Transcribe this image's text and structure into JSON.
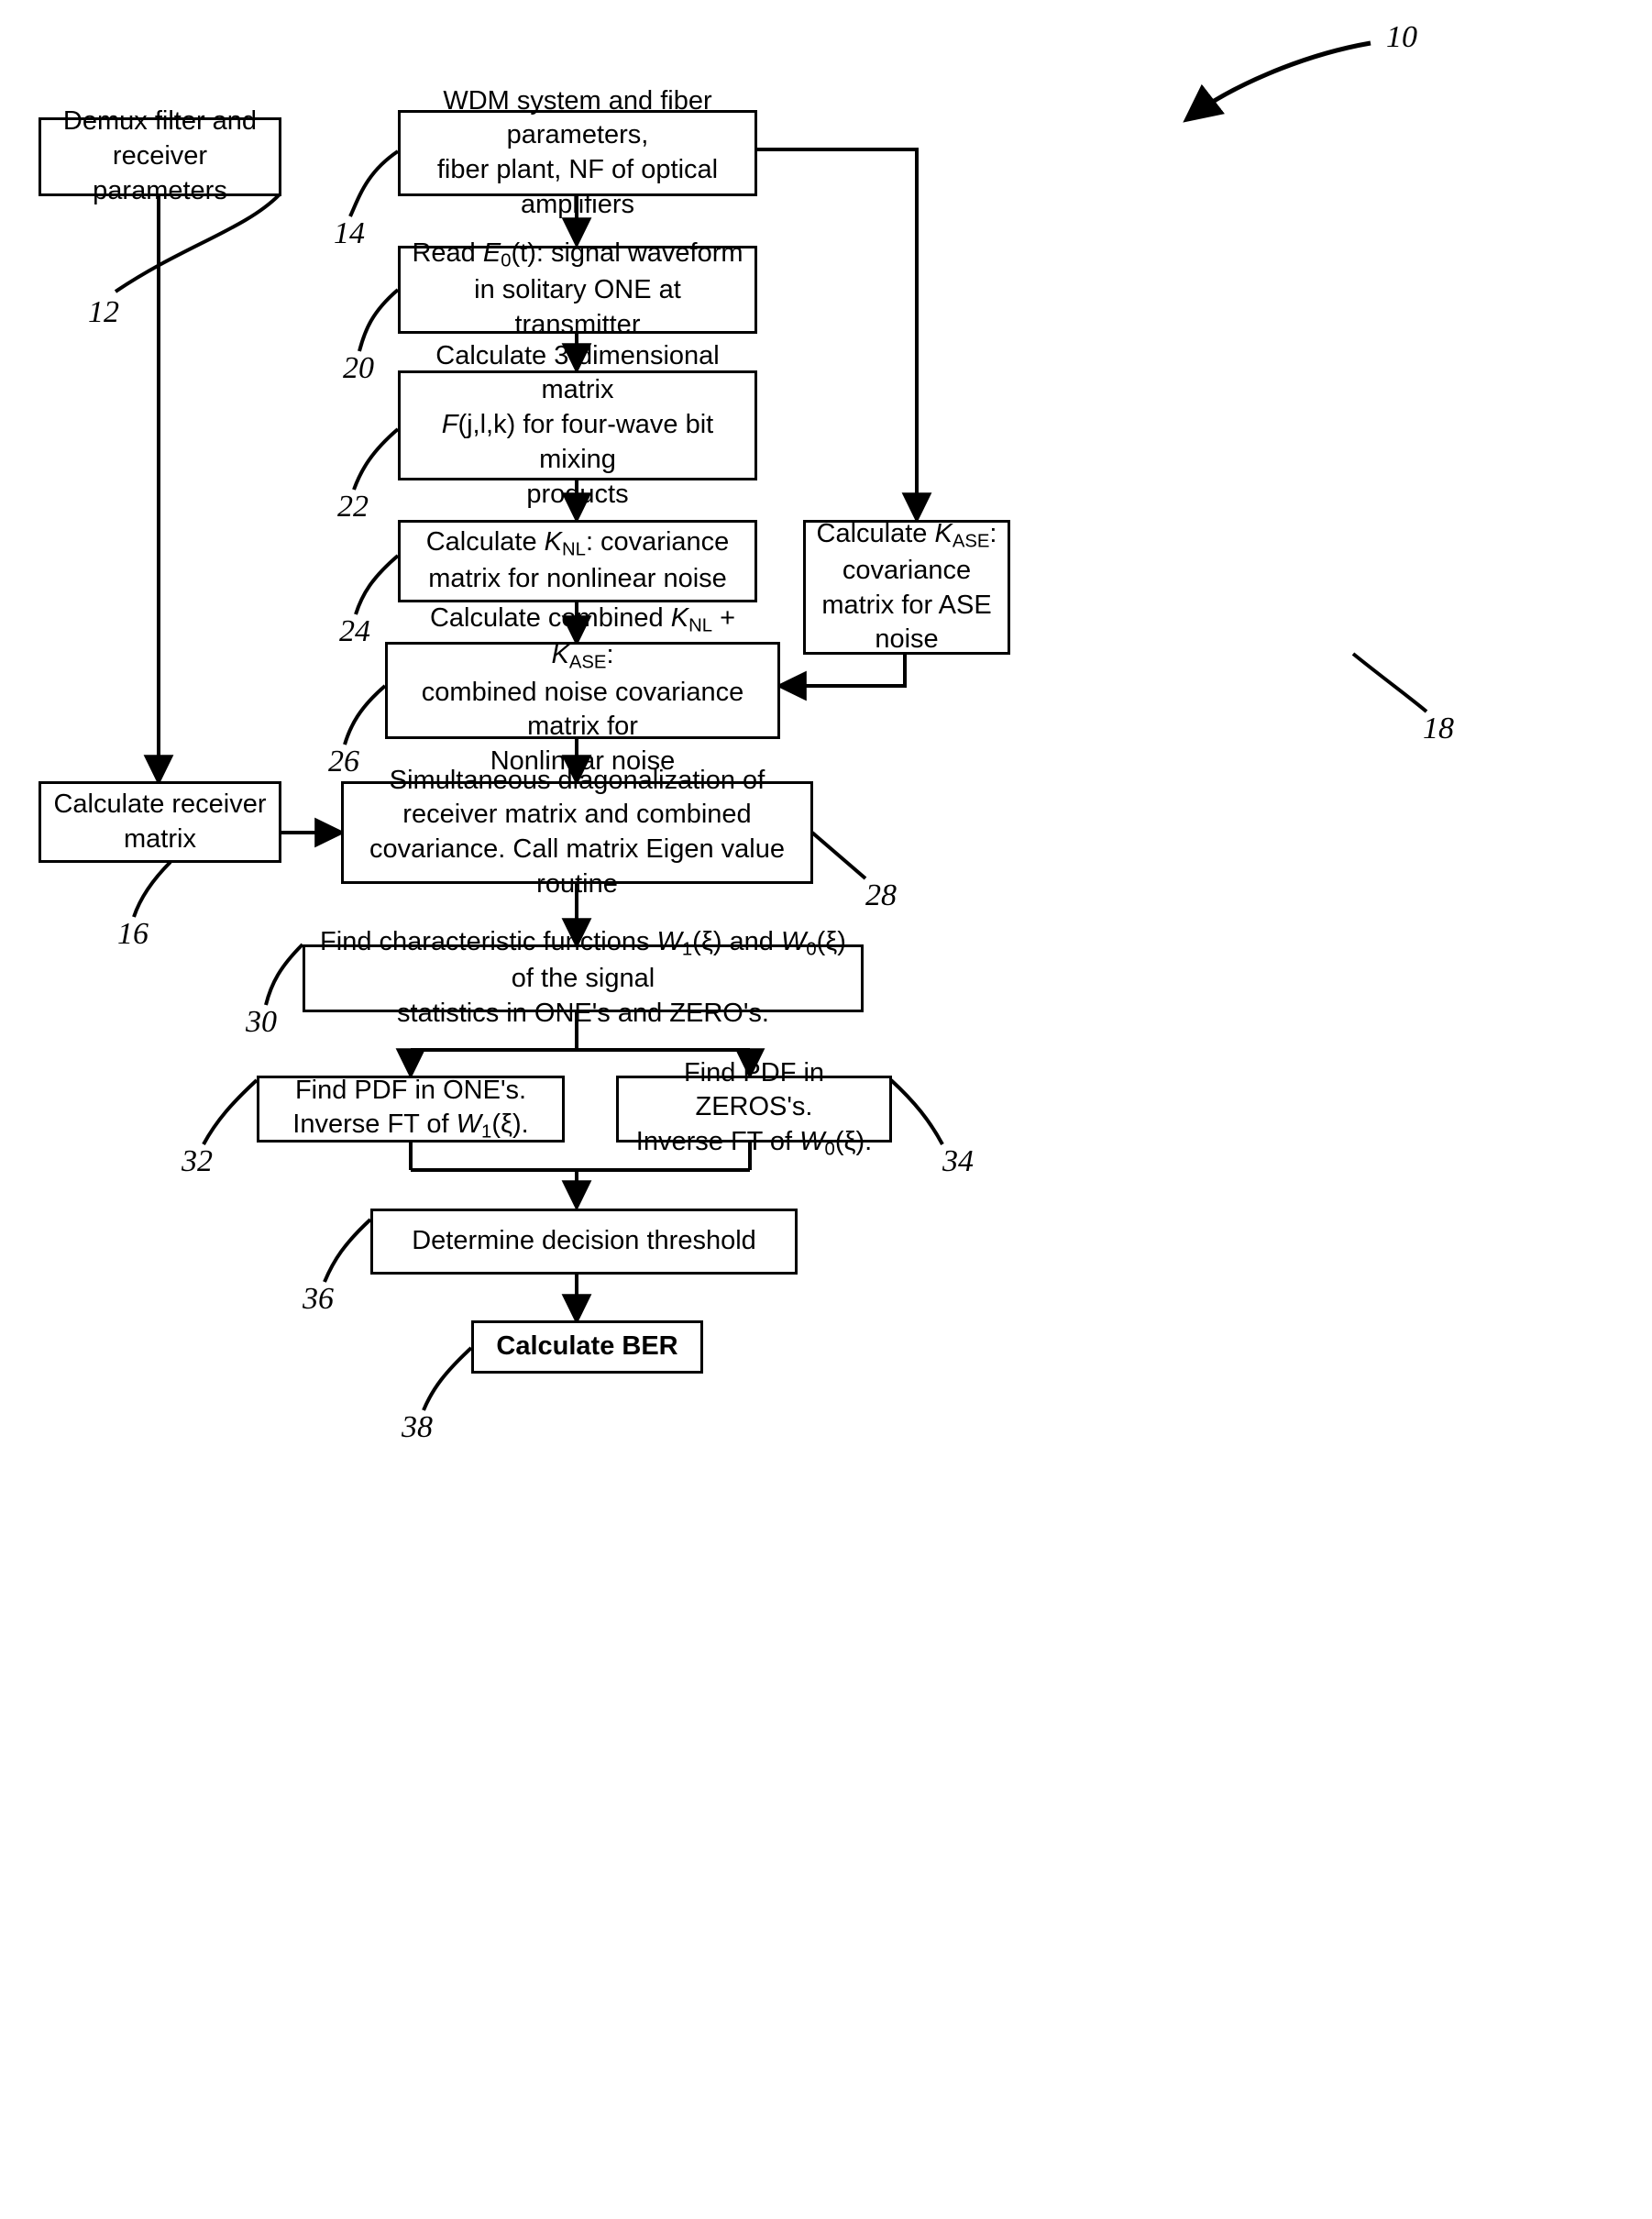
{
  "figure": {
    "reference_label": "10"
  },
  "boxes": [
    {
      "id": "demux",
      "ref": "12",
      "lines": [
        "Demux filter and",
        "receiver parameters"
      ]
    },
    {
      "id": "wdm",
      "ref": "14",
      "lines": [
        "WDM system and fiber parameters,",
        "fiber plant, NF of optical amplifiers"
      ]
    },
    {
      "id": "read-e0",
      "ref": "20",
      "lines": [
        "Read E0(t): signal waveform",
        "in solitary ONE at transmitter"
      ]
    },
    {
      "id": "matrix-f",
      "ref": "22",
      "lines": [
        "Calculate 3-dimensional matrix",
        "F(j,l,k) for four-wave bit mixing",
        "products"
      ]
    },
    {
      "id": "knl",
      "ref": "24",
      "lines": [
        "Calculate KNL: covariance",
        "matrix for nonlinear noise"
      ]
    },
    {
      "id": "kase",
      "ref": "18",
      "lines": [
        "Calculate KASE:",
        "covariance",
        "matrix for ASE",
        "noise"
      ]
    },
    {
      "id": "combined",
      "ref": "26",
      "lines": [
        "Calculate combined KNL + KASE:",
        "combined noise covariance matrix for",
        "Nonlinear noise"
      ]
    },
    {
      "id": "receiver-matrix",
      "ref": "16",
      "lines": [
        "Calculate receiver",
        "matrix"
      ]
    },
    {
      "id": "diagonalization",
      "ref": "28",
      "lines": [
        "Simultaneous diagonalization of",
        "receiver matrix and combined",
        "covariance.  Call matrix Eigen value routine"
      ]
    },
    {
      "id": "char-functions",
      "ref": "30",
      "lines": [
        "Find characteristic functions W1(ξ) and W0(ξ) of the signal",
        "statistics in ONE's and ZERO's."
      ]
    },
    {
      "id": "pdf-ones",
      "ref": "32",
      "lines": [
        "Find PDF in ONE's.",
        "Inverse FT of W1(ξ)."
      ]
    },
    {
      "id": "pdf-zeros",
      "ref": "34",
      "lines": [
        "Find PDF in ZEROS's.",
        "Inverse FT of W0(ξ)."
      ]
    },
    {
      "id": "threshold",
      "ref": "36",
      "lines": [
        "Determine decision threshold"
      ]
    },
    {
      "id": "ber",
      "ref": "38",
      "lines": [
        "Calculate BER"
      ]
    }
  ],
  "text": {
    "demux_l1": "Demux filter and",
    "demux_l2": "receiver parameters",
    "wdm_l1": "WDM system and fiber parameters,",
    "wdm_l2": "fiber plant, NF of optical amplifiers",
    "read_l1_a": "Read ",
    "read_l1_var": "E",
    "read_l1_sub": "0",
    "read_l1_b": "(t): signal waveform",
    "read_l2": "in solitary ONE at transmitter",
    "matrix_l1": "Calculate 3-dimensional matrix",
    "matrix_l2_var": "F",
    "matrix_l2_b": "(j,l,k) for four-wave bit mixing",
    "matrix_l3": "products",
    "knl_l1_a": "Calculate ",
    "knl_l1_var": "K",
    "knl_l1_sub": "NL",
    "knl_l1_b": ": covariance",
    "knl_l2": "matrix for nonlinear noise",
    "kase_l1_a": "Calculate ",
    "kase_l1_var": "K",
    "kase_l1_sub": "ASE",
    "kase_l1_b": ":",
    "kase_l2": "covariance",
    "kase_l3": "matrix for ASE",
    "kase_l4": "noise",
    "comb_l1_a": "Calculate combined ",
    "comb_l1_var1": "K",
    "comb_l1_sub1": "NL",
    "comb_l1_plus": " + ",
    "comb_l1_var2": "K",
    "comb_l1_sub2": "ASE",
    "comb_l1_b": ":",
    "comb_l2": "combined noise covariance matrix for",
    "comb_l3": "Nonlinear noise",
    "recv_l1": "Calculate receiver",
    "recv_l2": "matrix",
    "diag_l1": "Simultaneous diagonalization of",
    "diag_l2": "receiver matrix and combined",
    "diag_l3": "covariance.  Call matrix Eigen value routine",
    "char_l1_a": "Find characteristic functions ",
    "char_l1_w1": "W",
    "char_l1_w1sub": "1",
    "char_l1_mid": "(ξ) and ",
    "char_l1_w0": "W",
    "char_l1_w0sub": "0",
    "char_l1_b": "(ξ) of the signal",
    "char_l2": "statistics in ONE's and ZERO's.",
    "pdf1_l1": "Find PDF in ONE's.",
    "pdf1_l2_a": "Inverse FT of ",
    "pdf1_l2_w": "W",
    "pdf1_l2_sub": "1",
    "pdf1_l2_b": "(ξ).",
    "pdf0_l1": "Find PDF in ZEROS's.",
    "pdf0_l2_a": "Inverse FT of ",
    "pdf0_l2_w": "W",
    "pdf0_l2_sub": "0",
    "pdf0_l2_b": "(ξ).",
    "threshold": "Determine decision threshold",
    "ber": "Calculate BER"
  },
  "refs": {
    "r10": "10",
    "r12": "12",
    "r14": "14",
    "r16": "16",
    "r18": "18",
    "r20": "20",
    "r22": "22",
    "r24": "24",
    "r26": "26",
    "r28": "28",
    "r30": "30",
    "r32": "32",
    "r34": "34",
    "r36": "36",
    "r38": "38"
  },
  "colors": {
    "stroke": "#000000",
    "background": "#ffffff"
  }
}
